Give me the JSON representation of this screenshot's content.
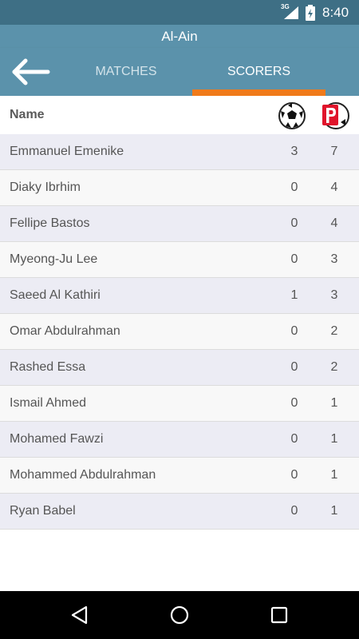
{
  "status_bar": {
    "network": "3G",
    "time": "8:40",
    "icons": [
      "signal-icon",
      "battery-icon"
    ]
  },
  "header": {
    "title": "Al-Ain"
  },
  "tabs": [
    {
      "label": "MATCHES",
      "selected": false
    },
    {
      "label": "SCORERS",
      "selected": true
    }
  ],
  "colors": {
    "status_bar": "#3e6f85",
    "app_bar": "#5b92ab",
    "tab_indicator": "#f07a1a",
    "row_alt": "#ececf4"
  },
  "table": {
    "name_header": "Name",
    "goals_icon": "soccer-ball-icon",
    "penalties_icon": "penalty-icon",
    "rows": [
      {
        "name": "Emmanuel Emenike",
        "goals": "3",
        "penalties": "7"
      },
      {
        "name": "Diaky Ibrhim",
        "goals": "0",
        "penalties": "4"
      },
      {
        "name": "Fellipe Bastos",
        "goals": "0",
        "penalties": "4"
      },
      {
        "name": "Myeong-Ju Lee",
        "goals": "0",
        "penalties": "3"
      },
      {
        "name": "Saeed Al Kathiri",
        "goals": "1",
        "penalties": "3"
      },
      {
        "name": "Omar Abdulrahman",
        "goals": "0",
        "penalties": "2"
      },
      {
        "name": "Rashed Essa",
        "goals": "0",
        "penalties": "2"
      },
      {
        "name": "Ismail Ahmed",
        "goals": "0",
        "penalties": "1"
      },
      {
        "name": "Mohamed Fawzi",
        "goals": "0",
        "penalties": "1"
      },
      {
        "name": "Mohammed Abdulrahman",
        "goals": "0",
        "penalties": "1"
      },
      {
        "name": "Ryan Babel",
        "goals": "0",
        "penalties": "1"
      }
    ]
  },
  "nav_bar": {
    "icons": [
      "nav-back-icon",
      "nav-home-icon",
      "nav-recent-icon"
    ]
  }
}
